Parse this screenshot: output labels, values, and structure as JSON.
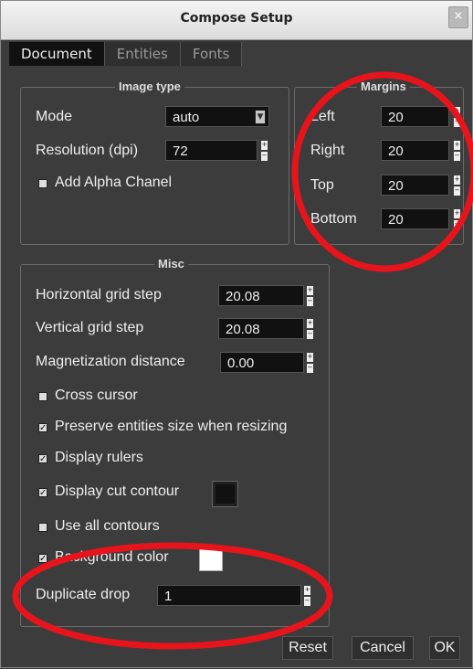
{
  "window": {
    "title": "Compose Setup",
    "close_glyph": "×"
  },
  "tabs": [
    {
      "label": "Document",
      "active": true
    },
    {
      "label": "Entities",
      "active": false
    },
    {
      "label": "Fonts",
      "active": false
    }
  ],
  "image_type": {
    "title": "Image type",
    "mode_label": "Mode",
    "mode_value": "auto",
    "resolution_label": "Resolution (dpi)",
    "resolution_value": "72",
    "alpha_label": "Add Alpha Chanel",
    "alpha_checked": false
  },
  "margins": {
    "title": "Margins",
    "left_label": "Left",
    "left_value": "20",
    "right_label": "Right",
    "right_value": "20",
    "top_label": "Top",
    "top_value": "20",
    "bottom_label": "Bottom",
    "bottom_value": "20"
  },
  "misc": {
    "title": "Misc",
    "hgrid_label": "Horizontal grid step",
    "hgrid_value": "20.08",
    "vgrid_label": "Vertical grid step",
    "vgrid_value": "20.08",
    "magnet_label": "Magnetization distance",
    "magnet_value": "0.00",
    "cross_cursor_label": "Cross cursor",
    "cross_cursor_checked": false,
    "preserve_label": "Preserve entities size when resizing",
    "preserve_checked": true,
    "rulers_label": "Display rulers",
    "rulers_checked": true,
    "cut_contour_label": "Display cut contour",
    "cut_contour_checked": true,
    "cut_contour_color": "#111111",
    "all_contours_label": "Use all contours",
    "all_contours_checked": false,
    "bg_color_label": "Background color",
    "bg_color_checked": true,
    "bg_color": "#ffffff",
    "dup_drop_label": "Duplicate drop",
    "dup_drop_value": "1"
  },
  "buttons": {
    "reset": "Reset",
    "cancel": "Cancel",
    "ok": "OK"
  },
  "annotation_color": "#e8141c"
}
